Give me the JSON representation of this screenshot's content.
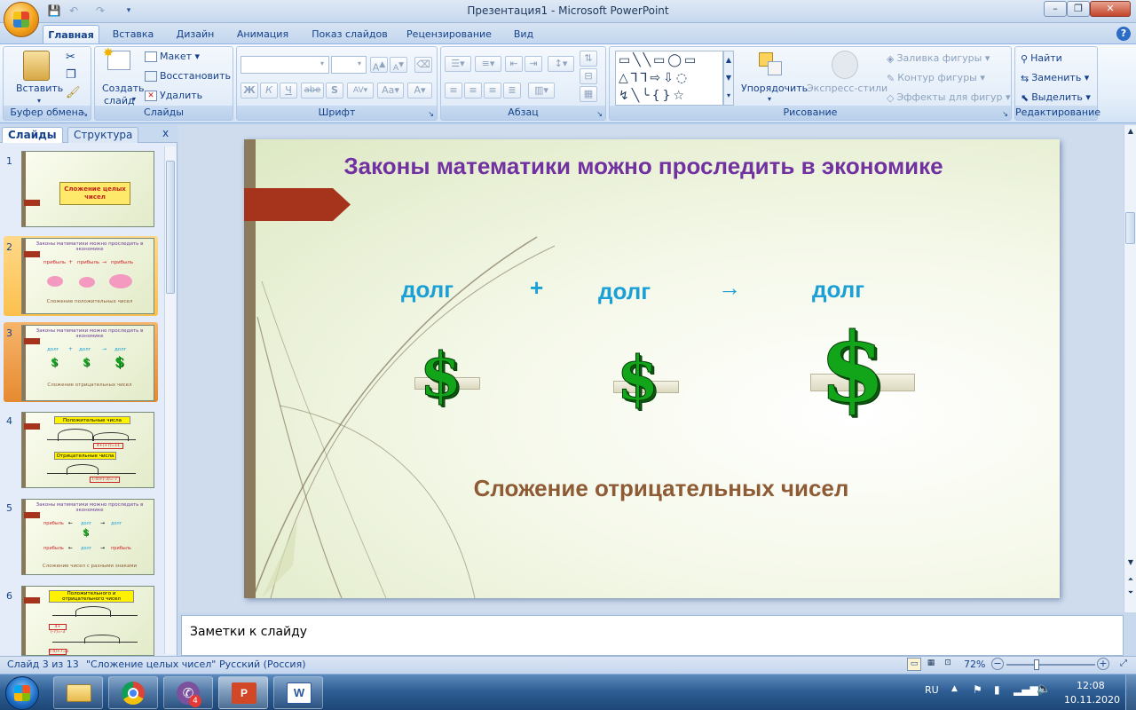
{
  "window": {
    "title": "Презентация1 - Microsoft PowerPoint"
  },
  "tabs": [
    "Главная",
    "Вставка",
    "Дизайн",
    "Анимация",
    "Показ слайдов",
    "Рецензирование",
    "Вид"
  ],
  "ribbon": {
    "clipboard": {
      "label": "Буфер обмена",
      "paste": "Вставить"
    },
    "slides": {
      "label": "Слайды",
      "new_slide_line1": "Создать",
      "new_slide_line2": "слайд",
      "layout": "Макет",
      "reset": "Восстановить",
      "delete": "Удалить"
    },
    "font": {
      "label": "Шрифт",
      "font_name": "",
      "font_size": "",
      "bold": "Ж",
      "italic": "К",
      "underline": "Ч",
      "strike": "abe",
      "shadow": "S"
    },
    "paragraph": {
      "label": "Абзац"
    },
    "drawing": {
      "label": "Рисование",
      "arrange": "Упорядочить",
      "quick_styles": "Экспресс-стили",
      "fill": "Заливка фигуры",
      "outline": "Контур фигуры",
      "effects": "Эффекты для фигур"
    },
    "editing": {
      "label": "Редактирование",
      "find": "Найти",
      "replace": "Заменить",
      "select": "Выделить"
    }
  },
  "left_panel": {
    "tab_slides": "Слайды",
    "tab_outline": "Структура",
    "close": "x",
    "thumbnails": [
      {
        "num": "1",
        "title": "Сложение целых чисел"
      },
      {
        "num": "2",
        "title": "Законы математики можно проследить в экономике",
        "row": [
          "прибыль",
          "+",
          "прибыль",
          "→",
          "прибыль"
        ],
        "caption": "Сложение положительных чисел"
      },
      {
        "num": "3",
        "title": "Законы математики можно проследить в экономике",
        "row": [
          "долг",
          "+",
          "долг",
          "→",
          "долг"
        ],
        "caption": "Сложение отрицательных чисел"
      },
      {
        "num": "4",
        "title": "Положительные числа",
        "title2": "Отрицательные числа",
        "formula1": "4+(+7)=11",
        "formula2": "(-4)+(-3)=-7"
      },
      {
        "num": "5",
        "title": "Законы математики можно проследить в экономике",
        "row1": [
          "прибыль",
          "←",
          "долг",
          "→",
          "долг"
        ],
        "row2": [
          "прибыль",
          "←",
          "долг",
          "→",
          "прибыль"
        ],
        "caption": "Сложение чисел с разными знаками"
      },
      {
        "num": "6",
        "title": "Положительного и отрицательного чисел",
        "formula1": "4+(-7)=-3",
        "formula2": "(-4)+7=3"
      }
    ]
  },
  "slide": {
    "title": "Законы математики можно проследить в экономике",
    "word1": "долг",
    "plus": "+",
    "word2": "долг",
    "arrow": "→",
    "word3": "долг",
    "dollar": "$",
    "subtitle": "Сложение отрицательных чисел"
  },
  "notes": {
    "placeholder": "Заметки к слайду"
  },
  "status": {
    "slide_pos": "Слайд 3 из 13",
    "theme": "\"Сложение целых чисел\"",
    "lang": "Русский (Россия)",
    "zoom": "72%"
  },
  "taskbar": {
    "viber_badge": "4",
    "lang": "RU",
    "time": "12:08",
    "date": "10.11.2020"
  },
  "colors": {
    "title": "#7131a1",
    "dolg": "#1ba0d6",
    "subtitle": "#8e5b34",
    "dollar": "#12a51a",
    "accent_arrow": "#a6341d"
  }
}
